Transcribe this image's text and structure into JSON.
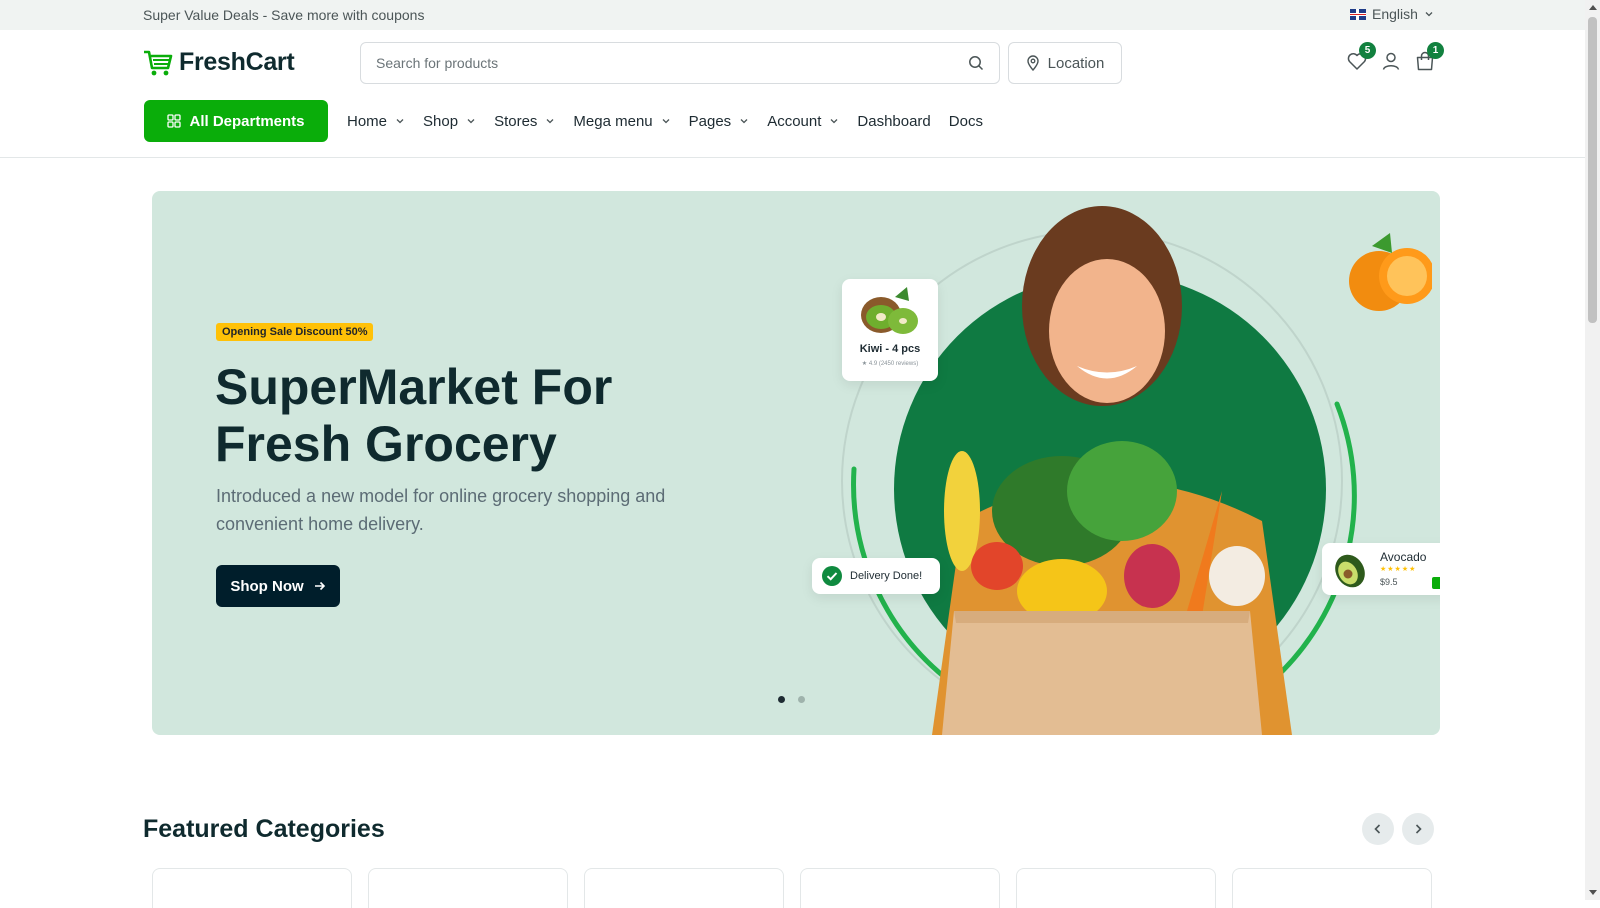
{
  "topbar": {
    "promo": "Super Value Deals - Save more with coupons",
    "language": "English"
  },
  "brand": {
    "name": "FreshCart",
    "accent": "#0aad0a",
    "dark": "#001e2b",
    "badge": "#12813f"
  },
  "search": {
    "placeholder": "Search for products",
    "value": ""
  },
  "location_button": {
    "label": "Location"
  },
  "header_icons": [
    {
      "icon": "heart-icon",
      "badge": "5"
    },
    {
      "icon": "user-icon"
    },
    {
      "icon": "shopping-bag-icon",
      "badge": "1"
    }
  ],
  "departments_button": {
    "label": "All Departments"
  },
  "nav": {
    "items": [
      {
        "label": "Home",
        "dropdown": true
      },
      {
        "label": "Shop",
        "dropdown": true
      },
      {
        "label": "Stores",
        "dropdown": true
      },
      {
        "label": "Mega menu",
        "dropdown": true
      },
      {
        "label": "Pages",
        "dropdown": true
      },
      {
        "label": "Account",
        "dropdown": true
      },
      {
        "label": "Dashboard",
        "dropdown": false
      },
      {
        "label": "Docs",
        "dropdown": false
      }
    ]
  },
  "hero": {
    "badge": "Opening Sale Discount 50%",
    "title": "SuperMarket For Fresh Grocery",
    "subtitle": "Introduced a new model for online grocery shopping and convenient home delivery.",
    "cta": "Shop Now",
    "bg_color": "#d1e7dd",
    "slide_count": 2,
    "active_slide": 1,
    "kiwi_card": {
      "title": "Kiwi - 4 pcs",
      "rating": "★ 4.9 (2450 reviews)"
    },
    "delivery_card": {
      "text": "Delivery Done!"
    },
    "avocado_card": {
      "title": "Avocado",
      "stars": "★★★★★",
      "price": "$9.5"
    }
  },
  "featured": {
    "title": "Featured Categories"
  }
}
